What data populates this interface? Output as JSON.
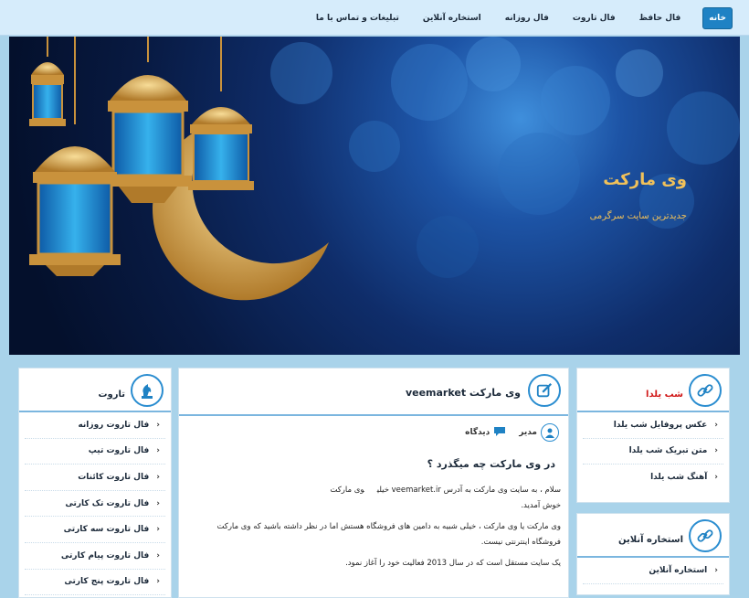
{
  "nav": {
    "items": [
      "خانه",
      "فال حافظ",
      "فال تاروت",
      "فال روزانه",
      "استخاره آنلاین",
      "تبلیغات و تماس با ما"
    ]
  },
  "hero": {
    "title": "وی مارکت",
    "subtitle": "جدیدترین سایت سرگرمی"
  },
  "right_panel1": {
    "title": "شب یلدا",
    "items": [
      "عکس پروفایل شب یلدا",
      "متن تبریک شب یلدا",
      "آهنگ شب یلدا"
    ]
  },
  "right_panel2": {
    "title": "استخاره آنلاین",
    "items": [
      "استخاره آنلاین"
    ]
  },
  "center": {
    "title": "وی مارکت veemarket",
    "author": "مدیر",
    "category": "دیدگاه",
    "heading": "در وی مارکت چه میگذرد ؟",
    "p1a": "سلام ، به سایت وی مارکت به آدرس veemarket.ir خیلی",
    "p1b": "وی مارکت",
    "p1c": "خوش آمدید.",
    "p2": "وی مارکت یا وی مارکت ، خیلی شبیه به دامین های فروشگاه هستش اما در نظر داشته باشید که وی مارکت فروشگاه اینترنتی نیست.",
    "p3": "یک سایت مستقل است که در سال 2013 فعالیت خود را آغاز نمود."
  },
  "left_panel": {
    "title": "تاروت",
    "items": [
      "فال تاروت روزانه",
      "فال تاروت تیپ",
      "فال تاروت کائنات",
      "فال تاروت تک کارتی",
      "فال تاروت سه کارتی",
      "فال تاروت پیام کارتی",
      "فال تاروت پنج کارتی"
    ]
  },
  "colors": {
    "accent": "#1f82c4",
    "hero_gold": "#f0c15a",
    "yalda_title": "#d11a1a"
  }
}
